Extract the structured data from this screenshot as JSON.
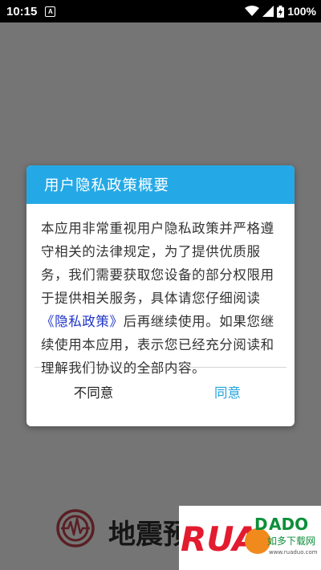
{
  "status_bar": {
    "time": "10:15",
    "notification_icon": "a-icon",
    "battery": "100%"
  },
  "dialog": {
    "title": "用户隐私政策概要",
    "body_before_link": "本应用非常重视用户隐私政策并严格遵守相关的法律规定，为了提供优质服务，我们需要获取您设备的部分权限用于提供相关服务，具体请您仔细阅读",
    "policy_link": "《隐私政策》",
    "body_after_link": "后再继续使用。如果您继续使用本应用，表示您已经充分阅读和理解我们协议的全部内容。",
    "disagree_label": "不同意",
    "agree_label": "同意"
  },
  "app": {
    "name": "地震预",
    "logo_icon": "seismograph-icon"
  },
  "watermark": {
    "brand": "RUANDADO",
    "sub": "如多下载网",
    "url": "www.ruaduo.com"
  },
  "colors": {
    "header": "#25a9e6",
    "agree": "#24a3dd",
    "link": "#1f33c7"
  }
}
